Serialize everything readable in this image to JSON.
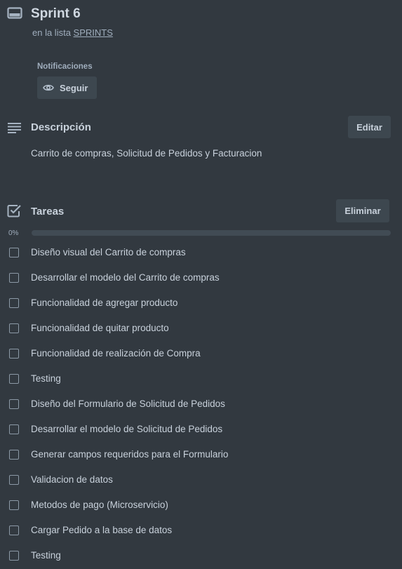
{
  "card": {
    "title": "Sprint 6",
    "list_prefix": "en la lista",
    "list_name": "SPRINTS"
  },
  "notifications": {
    "label": "Notificaciones",
    "follow_label": "Seguir"
  },
  "description": {
    "title": "Descripción",
    "edit_label": "Editar",
    "text": "Carrito de compras, Solicitud de Pedidos y Facturacion"
  },
  "checklist": {
    "title": "Tareas",
    "delete_label": "Eliminar",
    "progress_label": "0%",
    "progress": 0,
    "items": [
      {
        "text": "Diseño visual del Carrito de compras",
        "checked": false
      },
      {
        "text": "Desarrollar el modelo del Carrito de compras",
        "checked": false
      },
      {
        "text": "Funcionalidad de agregar producto",
        "checked": false
      },
      {
        "text": "Funcionalidad de quitar producto",
        "checked": false
      },
      {
        "text": "Funcionalidad de realización de Compra",
        "checked": false
      },
      {
        "text": "Testing",
        "checked": false
      },
      {
        "text": "Diseño del Formulario de Solicitud de Pedidos",
        "checked": false
      },
      {
        "text": "Desarrollar el modelo de Solicitud de Pedidos",
        "checked": false
      },
      {
        "text": "Generar campos requeridos para el Formulario",
        "checked": false
      },
      {
        "text": "Validacion de datos",
        "checked": false
      },
      {
        "text": "Metodos de pago (Microservicio)",
        "checked": false
      },
      {
        "text": "Cargar Pedido a la base de datos",
        "checked": false
      },
      {
        "text": "Testing",
        "checked": false
      }
    ]
  },
  "icons": {
    "card": "card-icon",
    "eye": "eye-icon",
    "description": "description-lines-icon",
    "checklist": "checkbox-checked-icon"
  }
}
